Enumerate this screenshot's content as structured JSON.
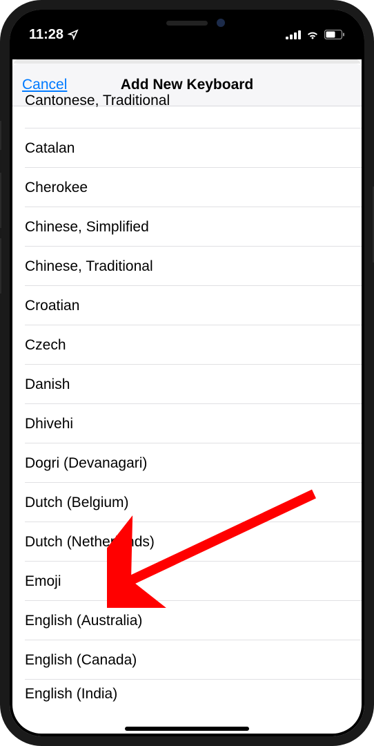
{
  "status": {
    "time": "11:28",
    "location_icon": "location-arrow",
    "signal_icon": "cellular-signal",
    "wifi_icon": "wifi",
    "battery_icon": "battery"
  },
  "nav": {
    "cancel": "Cancel",
    "title": "Add New Keyboard"
  },
  "keyboards": [
    "Cantonese, Traditional",
    "Catalan",
    "Cherokee",
    "Chinese, Simplified",
    "Chinese, Traditional",
    "Croatian",
    "Czech",
    "Danish",
    "Dhivehi",
    "Dogri (Devanagari)",
    "Dutch (Belgium)",
    "Dutch (Netherlands)",
    "Emoji",
    "English (Australia)",
    "English (Canada)",
    "English (India)"
  ],
  "annotation": {
    "target_index": 12,
    "color": "#ff0000"
  }
}
